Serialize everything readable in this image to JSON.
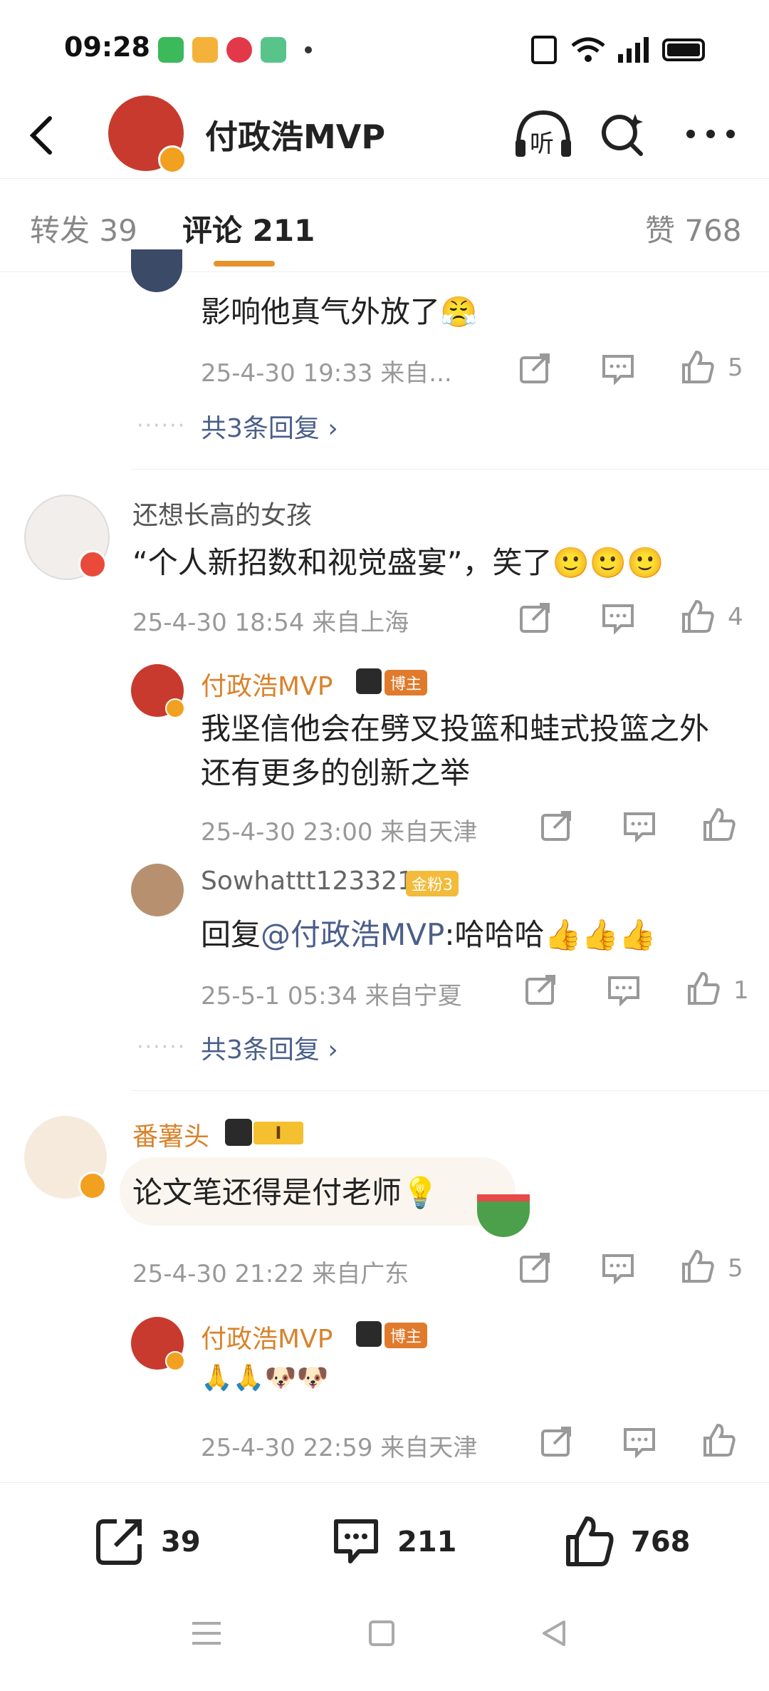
{
  "status": {
    "time": "09:28"
  },
  "header": {
    "title": "付政浩MVP",
    "listen_label": "听"
  },
  "tabs": {
    "repost": "转发 39",
    "comment": "评论 211",
    "like": "赞 768"
  },
  "thread1": {
    "text": "影响他真气外放了😤",
    "meta": "25-4-30 19:33  来自...",
    "likes": "5",
    "more_replies": "共3条回复 ›"
  },
  "c1": {
    "user": "还想长高的女孩",
    "text": "“个人新招数和视觉盛宴”，笑了🙂🙂🙂",
    "meta": "25-4-30 18:54  来自上海",
    "likes": "4",
    "r1": {
      "user": "付政浩MVP",
      "badge": "博主",
      "text": "我坚信他会在劈叉投篮和蛙式投篮之外还有更多的创新之举",
      "meta": "25-4-30 23:00  来自天津"
    },
    "r2": {
      "user": "Sowhattt123321",
      "badge": "金粉3",
      "reply_prefix": "回复",
      "mention": "@付政浩MVP",
      "text": ":哈哈哈👍👍👍",
      "meta": "25-5-1 05:34  来自宁夏",
      "likes": "1"
    },
    "more_replies": "共3条回复 ›"
  },
  "c2": {
    "user": "番薯头",
    "level": "I",
    "text": "论文笔还得是付老师💡",
    "meta": "25-4-30 21:22  来自广东",
    "likes": "5",
    "r1": {
      "user": "付政浩MVP",
      "badge": "博主",
      "text": "🙏🙏🐶🐶",
      "meta": "25-4-30 22:59  来自天津"
    }
  },
  "bottom": {
    "repost": "39",
    "comment": "211",
    "like": "768"
  },
  "colors": {
    "accent": "#d9822b",
    "link": "#4a5f8a",
    "tab_indicator": "#e8912c"
  }
}
